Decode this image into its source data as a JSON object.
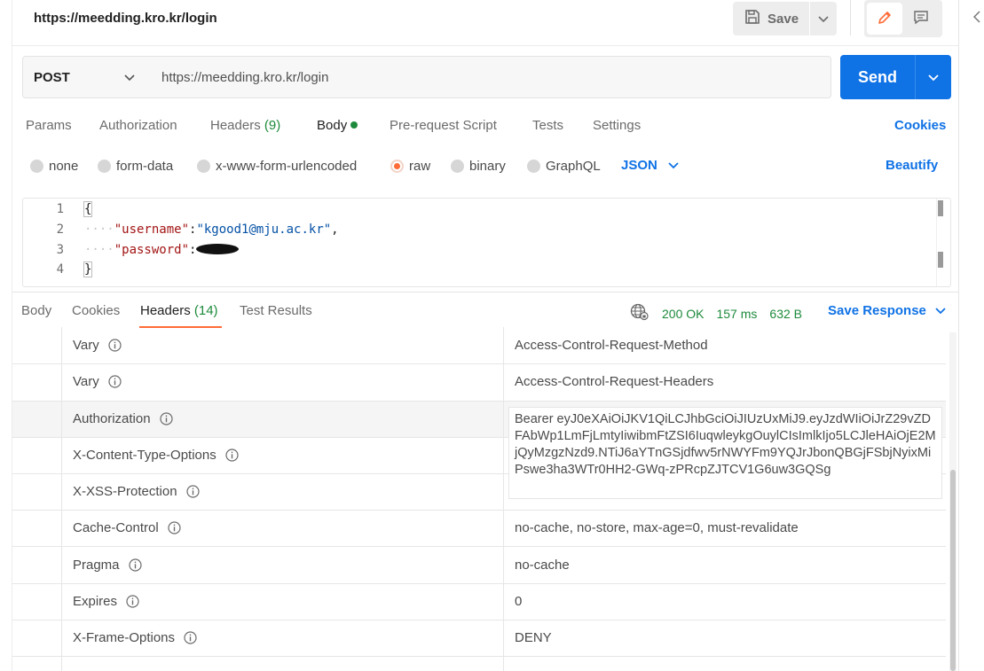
{
  "header": {
    "title": "https://meedding.kro.kr/login",
    "save_label": "Save"
  },
  "request": {
    "method": "POST",
    "url": "https://meedding.kro.kr/login",
    "send_label": "Send"
  },
  "request_tabs": {
    "params": "Params",
    "authorization": "Authorization",
    "headers": "Headers",
    "headers_count": "(9)",
    "body": "Body",
    "pre_request": "Pre-request Script",
    "tests": "Tests",
    "settings": "Settings",
    "cookies": "Cookies"
  },
  "body_types": {
    "none": "none",
    "form_data": "form-data",
    "urlencoded": "x-www-form-urlencoded",
    "raw": "raw",
    "binary": "binary",
    "graphql": "GraphQL",
    "language": "JSON",
    "beautify": "Beautify",
    "selected": "raw"
  },
  "editor": {
    "line_numbers": [
      "1",
      "2",
      "3",
      "4"
    ],
    "line1": "{",
    "line2_indent": "····",
    "line2_key": "\"username\"",
    "line2_colon": ":",
    "line2_value": "\"kgood1@mju.ac.kr\"",
    "line2_comma": ",",
    "line3_indent": "····",
    "line3_key": "\"password\"",
    "line3_colon": ":",
    "line4": "}"
  },
  "response_tabs": {
    "body": "Body",
    "cookies": "Cookies",
    "headers": "Headers",
    "headers_count": "(14)",
    "test_results": "Test Results"
  },
  "response_status": {
    "status": "200 OK",
    "time": "157 ms",
    "size": "632 B",
    "save_response": "Save Response"
  },
  "response_headers": [
    {
      "key": "Vary",
      "value": "Access-Control-Request-Method"
    },
    {
      "key": "Vary",
      "value": "Access-Control-Request-Headers"
    },
    {
      "key": "Authorization",
      "value": "Bearer eyJ0eXAiOiJKV1QiLCJhbGciOiJIUzUxMiJ9.eyJzdWIiOiJrZ29vZDFAbWp1LmFjLmtyIiwibmFtZSI6IuqwleykgOuylCIsImlkIjo5LCJleHAiOjE2MjQyMzgzNzd9.NTiJ6aYTnGSjdfwv5rNWYFm9YQJrJbonQBGjFSbjNyixMiPswe3ha3WTr0HH2-GWq-zPRcpZJTCV1G6uw3GQSg"
    },
    {
      "key": "X-Content-Type-Options",
      "value": ""
    },
    {
      "key": "X-XSS-Protection",
      "value": ""
    },
    {
      "key": "Cache-Control",
      "value": "no-cache, no-store, max-age=0, must-revalidate"
    },
    {
      "key": "Pragma",
      "value": "no-cache"
    },
    {
      "key": "Expires",
      "value": "0"
    },
    {
      "key": "X-Frame-Options",
      "value": "DENY"
    }
  ],
  "colors": {
    "accent_blue": "#0f72e5",
    "accent_orange": "#ff6c37",
    "status_green": "#1d8a3b"
  },
  "icons": [
    "save-icon",
    "chevron-down-icon",
    "pencil-icon",
    "comment-icon",
    "chevron-left-icon",
    "globe-icon",
    "info-icon"
  ]
}
